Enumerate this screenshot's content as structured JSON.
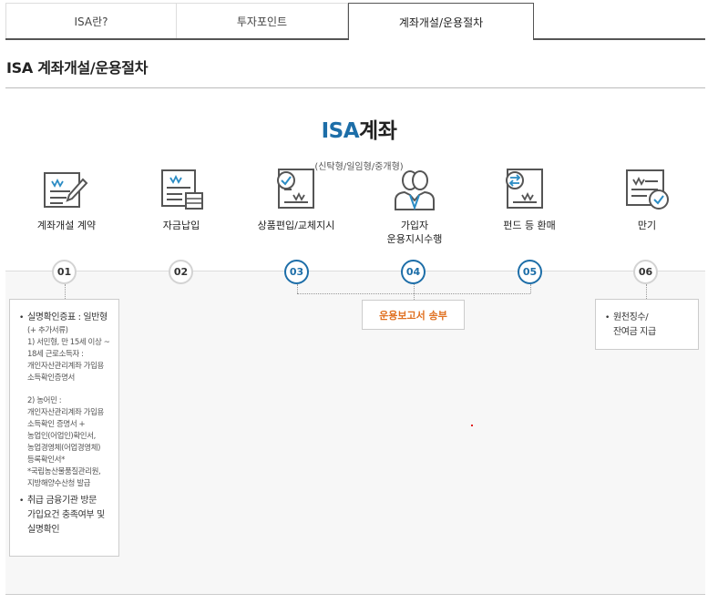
{
  "tabs": [
    {
      "label": "ISA란?",
      "active": false
    },
    {
      "label": "투자포인트",
      "active": false
    },
    {
      "label": "계좌개설/운용절차",
      "active": true
    }
  ],
  "page_title": "ISA 계좌개설/운용절차",
  "diagram": {
    "title_highlight": "ISA",
    "title_rest": "계좌",
    "subtitle": "(신탁형/일임형/중개형)",
    "steps": [
      {
        "num": "01",
        "label": "계좌개설 계약",
        "icon": "document-pen-icon"
      },
      {
        "num": "02",
        "label": "자금납입",
        "icon": "document-coins-icon"
      },
      {
        "num": "03",
        "label": "상품편입/교체지시",
        "icon": "document-check-icon"
      },
      {
        "num": "04",
        "label": "가입자\n운용지시수행",
        "icon": "people-icon"
      },
      {
        "num": "05",
        "label": "펀드 등 환매",
        "icon": "document-exchange-icon"
      },
      {
        "num": "06",
        "label": "만기",
        "icon": "document-check-circle-icon"
      }
    ],
    "report": "운용보고서 송부",
    "left_box": {
      "item1_title": "실명확인증표 : 일반형",
      "item1_lines": [
        "(+ 추가서류)",
        "1) 서민형, 만 15세 이상 ~",
        "18세 근로소득자 :",
        "개인자산관리계좌 가입용",
        "소득확인증명서",
        "",
        "2) 농어민 :",
        "개인자산관리계좌 가입용",
        "소득확인 증명서 +",
        "농업인(어업인)확인서,",
        "농업경영체(어업경영체)",
        "등록확인서*",
        "*국립농산물품질관리원,",
        "지방해양수산청 발급"
      ],
      "item2": "취급 금융기관 방문\n가입요건 충족여부 및\n실명확인"
    },
    "right_box": {
      "item": "원천징수/\n잔여금 지급"
    },
    "colors": {
      "accent": "#1d6ea8",
      "report": "#e07020"
    }
  }
}
